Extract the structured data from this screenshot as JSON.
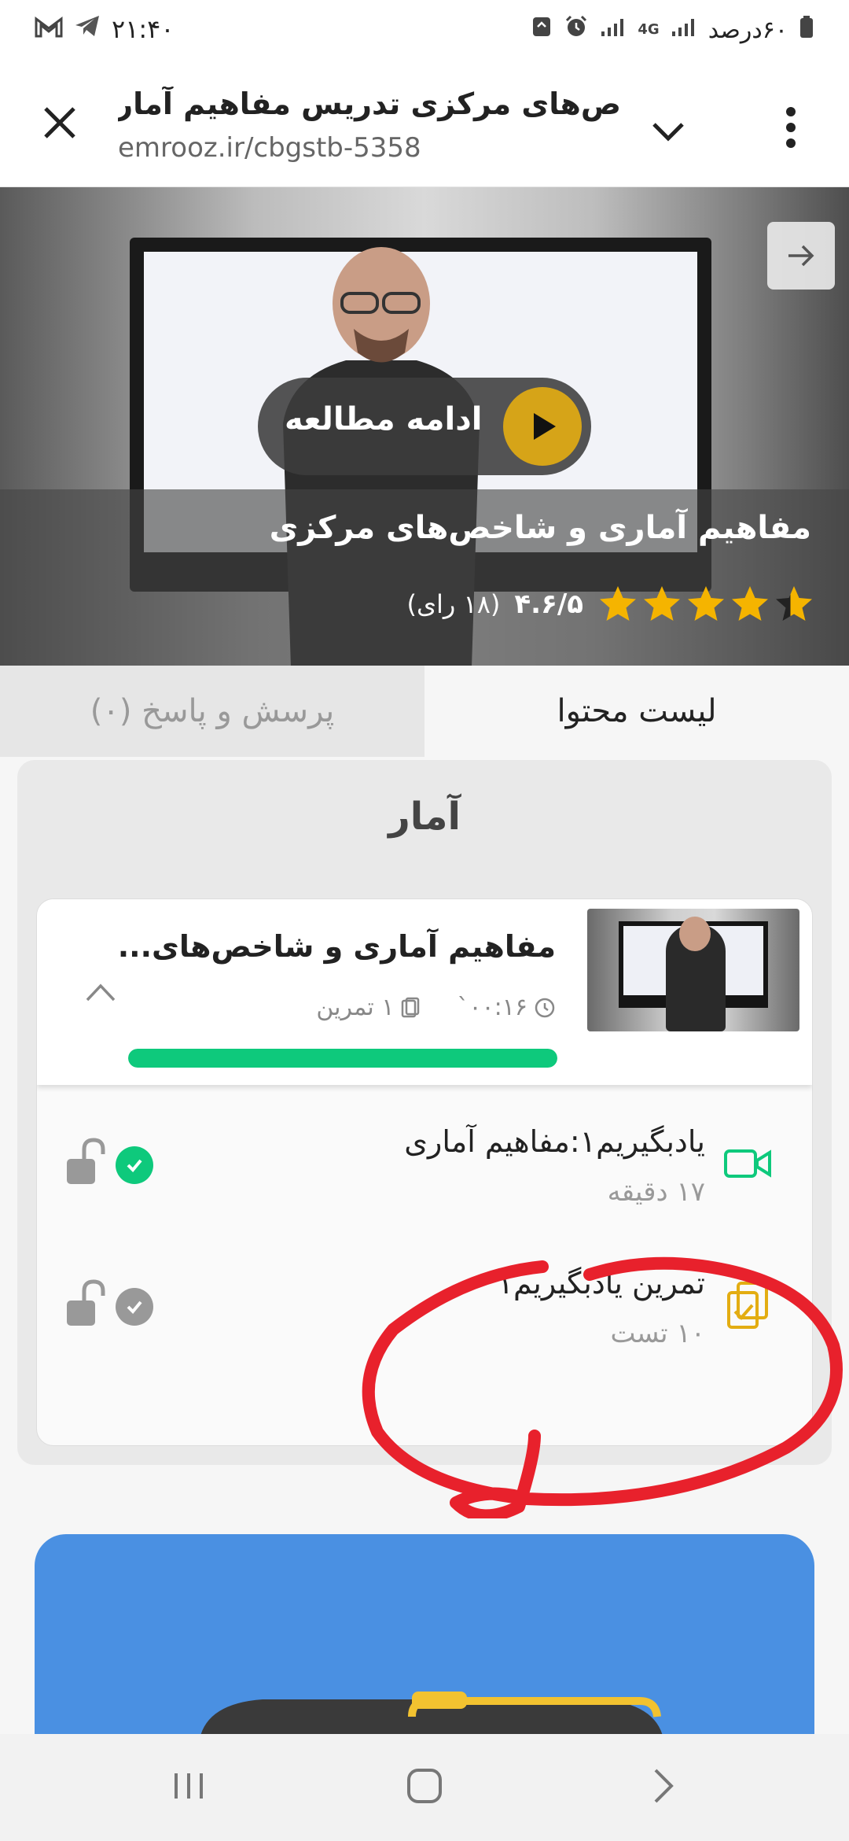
{
  "status_bar": {
    "time": "۲۱:۴۰",
    "battery_text": "۶۰درصد",
    "network": "4G"
  },
  "address_bar": {
    "title": "ص‌های مرکزی تدریس مفاهیم آماری و",
    "url": "emrooz.ir/cbgstb-5358"
  },
  "hero": {
    "continue_label": "ادامه مطالعه",
    "course_title": "مفاهیم آماری و شاخص‌های مرکزی",
    "rating_score": "۴.۶/۵",
    "rating_votes": "(۱۸ رای)",
    "rating_value": 4.6,
    "star_color": "#f5b400"
  },
  "tabs": [
    {
      "label": "لیست محتوا",
      "active": true
    },
    {
      "label": "پرسش و پاسخ (۰)",
      "active": false
    }
  ],
  "stats": {
    "heading": "آمار",
    "lesson": {
      "title": "مفاهیم آماری و شاخص‌های...",
      "duration": "۰۰:۱۶`",
      "exercises": "۱ تمرین",
      "progress": 1.0,
      "progress_color": "#0ec97c"
    },
    "items": [
      {
        "name": "یادبگیریم۱:مفاهیم آماری",
        "sub": "۱۷ دقیقه",
        "type": "video",
        "done": true
      },
      {
        "name": "تمرین یادبگیریم۱",
        "sub": "۱۰ تست",
        "type": "exercise",
        "done": false
      }
    ]
  },
  "colors": {
    "accent_green": "#0ec97c",
    "exercise_yellow": "#e3ad12",
    "play_gold": "#d6a418",
    "annotation_red": "#e8212c",
    "card_blue": "#4a90e2"
  }
}
